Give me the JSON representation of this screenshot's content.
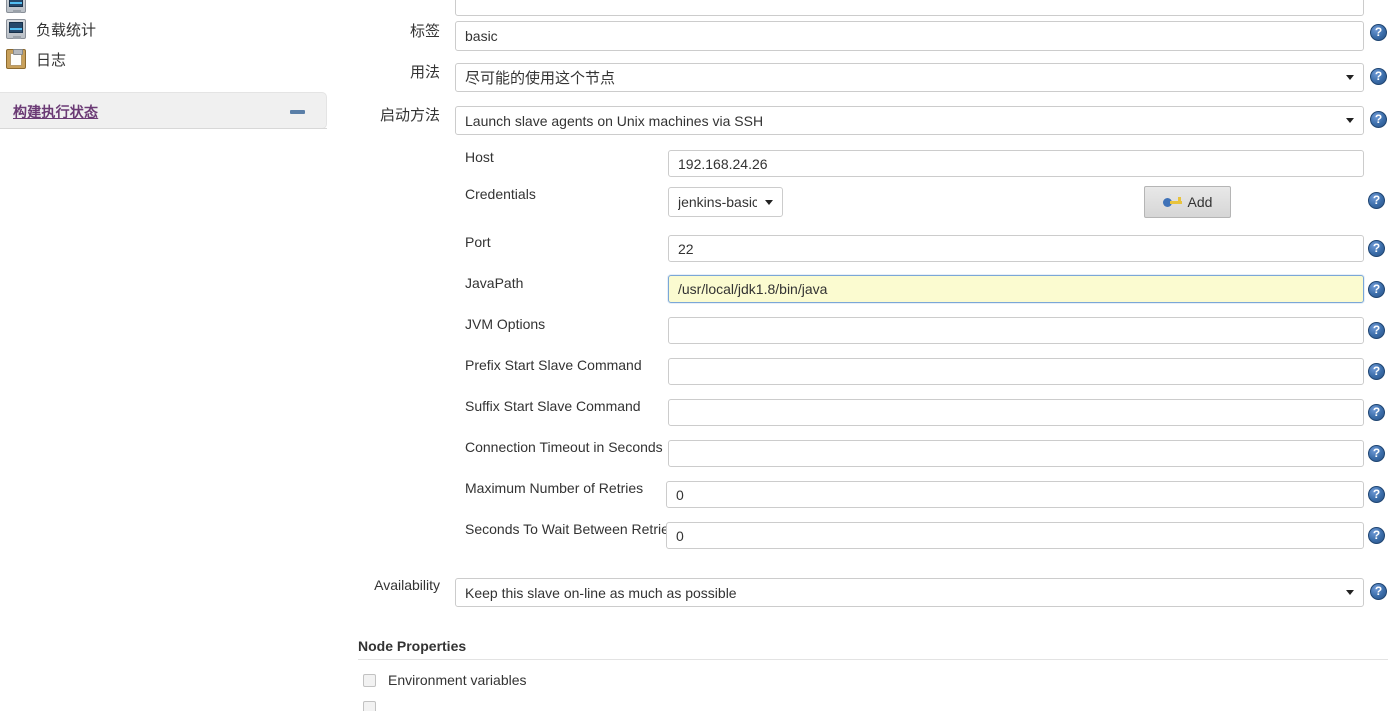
{
  "sidebar": {
    "tasks": [
      {
        "label": "负载统计",
        "icon": "monitor-icon"
      },
      {
        "label": "日志",
        "icon": "clipboard-icon"
      }
    ],
    "executor_panel": {
      "title": "构建执行状态",
      "collapse_icon": "minus-icon"
    }
  },
  "form": {
    "label_field": {
      "label": "标签",
      "value": "basic"
    },
    "usage": {
      "label": "用法",
      "value": "尽可能的使用这个节点"
    },
    "launch_method": {
      "label": "启动方法",
      "value": "Launch slave agents on Unix machines via SSH"
    },
    "ssh": {
      "host": {
        "label": "Host",
        "value": "192.168.24.26"
      },
      "credentials": {
        "label": "Credentials",
        "value": "jenkins-basic",
        "add_label": "Add",
        "add_icon": "key-icon"
      },
      "port": {
        "label": "Port",
        "value": "22"
      },
      "java_path": {
        "label": "JavaPath",
        "value": "/usr/local/jdk1.8/bin/java"
      },
      "jvm_options": {
        "label": "JVM Options",
        "value": ""
      },
      "prefix_start": {
        "label": "Prefix Start Slave Command",
        "value": ""
      },
      "suffix_start": {
        "label": "Suffix Start Slave Command",
        "value": ""
      },
      "conn_timeout": {
        "label": "Connection Timeout in Seconds",
        "value": ""
      },
      "max_retries": {
        "label": "Maximum Number of Retries",
        "value": "0"
      },
      "retry_wait": {
        "label": "Seconds To Wait Between Retries",
        "value": "0"
      }
    },
    "availability": {
      "label": "Availability",
      "value": "Keep this slave on-line as much as possible"
    },
    "node_properties": {
      "title": "Node Properties",
      "items": [
        {
          "label": "Environment variables",
          "checked": false
        }
      ]
    },
    "help_icon": "help-icon"
  },
  "colors": {
    "accent_link": "#6b3a75",
    "help_blue": "#3a6ca8",
    "highlight_field_bg": "#fbfbd0",
    "highlight_field_border": "#7ba7d7",
    "panel_bg": "#f0f0f0"
  }
}
